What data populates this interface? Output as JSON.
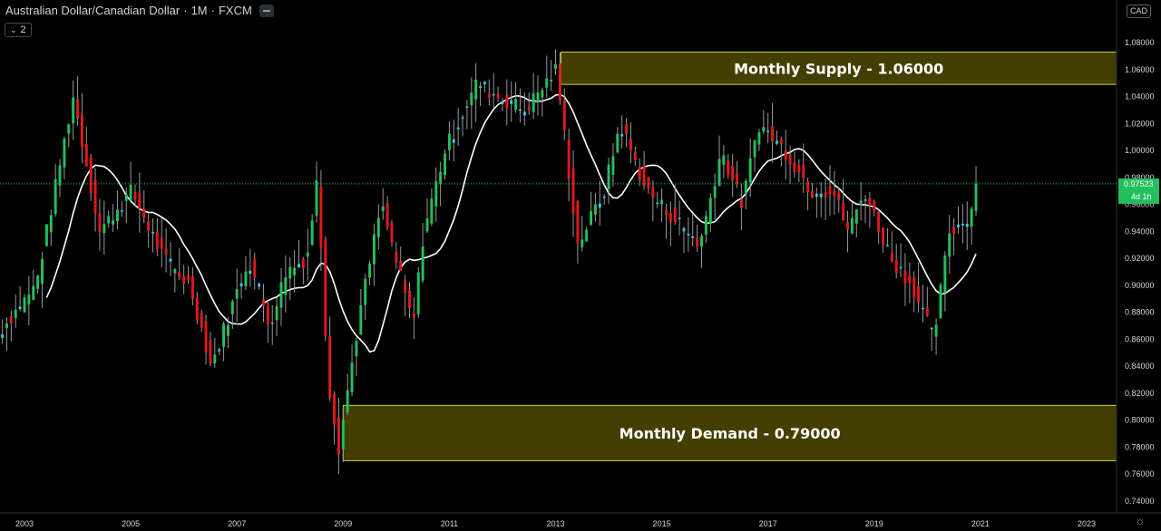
{
  "header": {
    "symbol": "Australian Dollar/Canadian Dollar",
    "interval": "1M",
    "exchange": "FXCM",
    "separator": "·",
    "indicator_count": "2",
    "currency": "CAD"
  },
  "price_badge": {
    "value": "0.97523",
    "countdown": "4d 1h"
  },
  "colors": {
    "background": "#000000",
    "up": "#22c05d",
    "down": "#e0191a",
    "doji": "#35c9e0",
    "ma": "#ffffff",
    "zone_fill": "#5a5400",
    "zone_border": "#d8d33a",
    "badge_bg": "#22c05d"
  },
  "chart_data": {
    "type": "candlestick",
    "title": "Australian Dollar/Canadian Dollar · 1M · FXCM",
    "ylim": [
      0.73,
      1.09
    ],
    "y_ticks": [
      "1.08000",
      "1.06000",
      "1.04000",
      "1.02000",
      "1.00000",
      "0.98000",
      "0.96000",
      "0.94000",
      "0.92000",
      "0.90000",
      "0.88000",
      "0.86000",
      "0.84000",
      "0.82000",
      "0.80000",
      "0.78000",
      "0.76000",
      "0.74000"
    ],
    "y_tick_values": [
      1.08,
      1.06,
      1.04,
      1.02,
      1.0,
      0.98,
      0.96,
      0.94,
      0.92,
      0.9,
      0.88,
      0.86,
      0.84,
      0.82,
      0.8,
      0.78,
      0.76,
      0.74
    ],
    "x_ticks": [
      "2003",
      "2005",
      "2007",
      "2009",
      "2011",
      "2013",
      "2015",
      "2017",
      "2019",
      "2021",
      "2023"
    ],
    "x_range": [
      2002.5,
      2024.0
    ],
    "last_price": 0.97523,
    "grid": false,
    "zones": [
      {
        "label": "Monthly Supply - 1.06000",
        "x_start": 2013.1,
        "x_end": 2024.0,
        "y_low": 1.049,
        "y_high": 1.073
      },
      {
        "label": "Monthly Demand - 0.79000",
        "x_start": 2009.0,
        "x_end": 2024.0,
        "y_low": 0.77,
        "y_high": 0.811
      }
    ],
    "key_prices": [
      {
        "x": 2002.5,
        "y": 0.86
      },
      {
        "x": 2003.3,
        "y": 0.9
      },
      {
        "x": 2004.0,
        "y": 1.04
      },
      {
        "x": 2004.5,
        "y": 0.94
      },
      {
        "x": 2005.1,
        "y": 0.97
      },
      {
        "x": 2005.7,
        "y": 0.92
      },
      {
        "x": 2006.2,
        "y": 0.9
      },
      {
        "x": 2006.6,
        "y": 0.84
      },
      {
        "x": 2007.3,
        "y": 0.92
      },
      {
        "x": 2007.7,
        "y": 0.87
      },
      {
        "x": 2008.0,
        "y": 0.91
      },
      {
        "x": 2008.4,
        "y": 0.92
      },
      {
        "x": 2008.6,
        "y": 0.98
      },
      {
        "x": 2008.8,
        "y": 0.83
      },
      {
        "x": 2009.0,
        "y": 0.78
      },
      {
        "x": 2009.4,
        "y": 0.88
      },
      {
        "x": 2009.8,
        "y": 0.96
      },
      {
        "x": 2010.4,
        "y": 0.87
      },
      {
        "x": 2010.6,
        "y": 0.94
      },
      {
        "x": 2011.0,
        "y": 1.0
      },
      {
        "x": 2011.6,
        "y": 1.05
      },
      {
        "x": 2012.0,
        "y": 1.04
      },
      {
        "x": 2012.5,
        "y": 1.03
      },
      {
        "x": 2013.1,
        "y": 1.06
      },
      {
        "x": 2013.5,
        "y": 0.93
      },
      {
        "x": 2014.0,
        "y": 0.97
      },
      {
        "x": 2014.3,
        "y": 1.02
      },
      {
        "x": 2014.8,
        "y": 0.97
      },
      {
        "x": 2015.3,
        "y": 0.95
      },
      {
        "x": 2015.8,
        "y": 0.93
      },
      {
        "x": 2016.2,
        "y": 1.0
      },
      {
        "x": 2016.6,
        "y": 0.96
      },
      {
        "x": 2016.9,
        "y": 1.02
      },
      {
        "x": 2017.4,
        "y": 1.0
      },
      {
        "x": 2017.9,
        "y": 0.97
      },
      {
        "x": 2018.3,
        "y": 0.97
      },
      {
        "x": 2018.6,
        "y": 0.94
      },
      {
        "x": 2018.9,
        "y": 0.97
      },
      {
        "x": 2019.4,
        "y": 0.92
      },
      {
        "x": 2019.8,
        "y": 0.9
      },
      {
        "x": 2020.2,
        "y": 0.86
      },
      {
        "x": 2020.5,
        "y": 0.94
      },
      {
        "x": 2020.9,
        "y": 0.95
      },
      {
        "x": 2020.95,
        "y": 0.975
      }
    ]
  }
}
